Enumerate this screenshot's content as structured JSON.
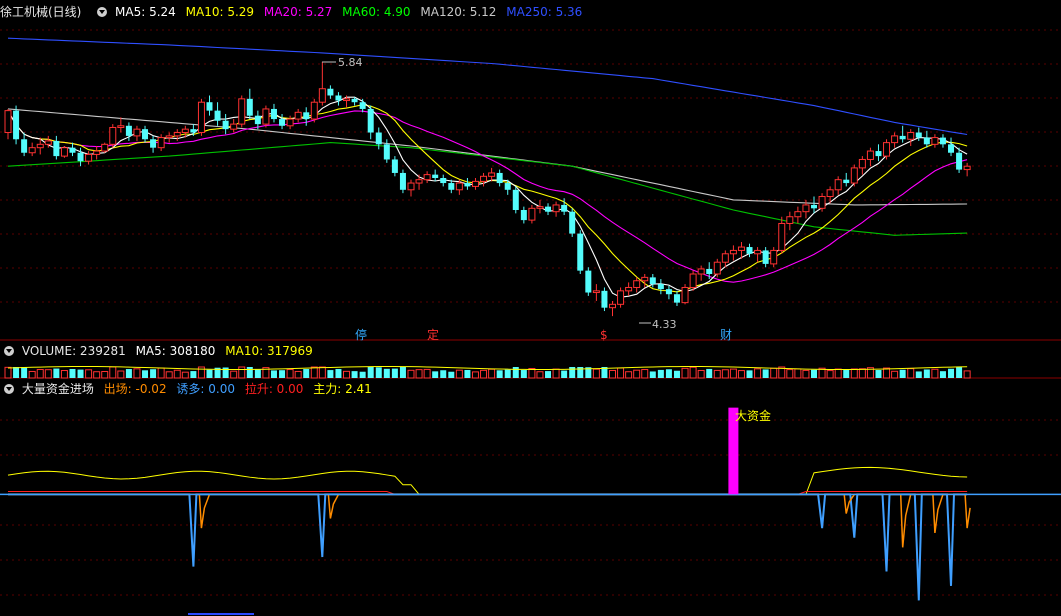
{
  "main_header": {
    "title": "徐工机械(日线)",
    "items": [
      {
        "label": "MA5: 5.24",
        "color": "#ffffff"
      },
      {
        "label": "MA10: 5.29",
        "color": "#ffff00"
      },
      {
        "label": "MA20: 5.27",
        "color": "#ff00ff"
      },
      {
        "label": "MA60: 4.90",
        "color": "#00ff00"
      },
      {
        "label": "MA120: 5.12",
        "color": "#c8c8c8"
      },
      {
        "label": "MA250: 5.36",
        "color": "#2f4fff"
      }
    ]
  },
  "volume_header": {
    "title": "VOLUME: 239281",
    "items": [
      {
        "label": "MA5: 308180",
        "color": "#ffffff"
      },
      {
        "label": "MA10: 317969",
        "color": "#ffff00"
      }
    ]
  },
  "indicator_header": {
    "title": "大量资金进场",
    "items": [
      {
        "label": "出场: -0.02",
        "color": "#ff8c00"
      },
      {
        "label": "诱多: 0.00",
        "color": "#3f9fff"
      },
      {
        "label": "拉升: 0.00",
        "color": "#ff2020"
      },
      {
        "label": "主力: 2.41",
        "color": "#ffff00"
      }
    ]
  },
  "annotations": {
    "high_label": "5.84",
    "low_label": "4.33",
    "big_money_label": "大资金",
    "markers": [
      {
        "text": "停",
        "color": "#33aaff"
      },
      {
        "text": "定",
        "color": "#ff3030"
      },
      {
        "text": "$",
        "color": "#ff3030"
      },
      {
        "text": "财",
        "color": "#33aaff"
      }
    ]
  },
  "chart_data": [
    {
      "type": "candlestick",
      "title": "徐工机械(日线)",
      "ylim": [
        4.2,
        6.1
      ],
      "price_high": 5.84,
      "price_low": 4.33,
      "candles": [
        [
          5.42,
          5.56,
          5.38,
          5.55
        ],
        [
          5.55,
          5.58,
          5.35,
          5.38
        ],
        [
          5.38,
          5.42,
          5.28,
          5.3
        ],
        [
          5.3,
          5.36,
          5.28,
          5.33
        ],
        [
          5.33,
          5.39,
          5.29,
          5.35
        ],
        [
          5.35,
          5.4,
          5.33,
          5.37
        ],
        [
          5.37,
          5.4,
          5.26,
          5.28
        ],
        [
          5.28,
          5.34,
          5.27,
          5.33
        ],
        [
          5.33,
          5.36,
          5.28,
          5.3
        ],
        [
          5.3,
          5.33,
          5.22,
          5.25
        ],
        [
          5.25,
          5.31,
          5.23,
          5.29
        ],
        [
          5.29,
          5.34,
          5.26,
          5.31
        ],
        [
          5.31,
          5.36,
          5.3,
          5.35
        ],
        [
          5.35,
          5.47,
          5.33,
          5.45
        ],
        [
          5.45,
          5.51,
          5.42,
          5.46
        ],
        [
          5.46,
          5.48,
          5.37,
          5.4
        ],
        [
          5.4,
          5.46,
          5.37,
          5.44
        ],
        [
          5.44,
          5.46,
          5.36,
          5.38
        ],
        [
          5.38,
          5.4,
          5.3,
          5.33
        ],
        [
          5.33,
          5.41,
          5.31,
          5.39
        ],
        [
          5.39,
          5.42,
          5.36,
          5.4
        ],
        [
          5.4,
          5.44,
          5.37,
          5.42
        ],
        [
          5.42,
          5.46,
          5.39,
          5.44
        ],
        [
          5.44,
          5.47,
          5.4,
          5.42
        ],
        [
          5.42,
          5.62,
          5.4,
          5.6
        ],
        [
          5.6,
          5.64,
          5.52,
          5.55
        ],
        [
          5.55,
          5.6,
          5.46,
          5.49
        ],
        [
          5.49,
          5.53,
          5.41,
          5.44
        ],
        [
          5.44,
          5.5,
          5.42,
          5.47
        ],
        [
          5.47,
          5.64,
          5.45,
          5.62
        ],
        [
          5.62,
          5.68,
          5.5,
          5.52
        ],
        [
          5.52,
          5.55,
          5.44,
          5.47
        ],
        [
          5.47,
          5.58,
          5.45,
          5.56
        ],
        [
          5.56,
          5.59,
          5.48,
          5.5
        ],
        [
          5.5,
          5.53,
          5.44,
          5.46
        ],
        [
          5.46,
          5.52,
          5.44,
          5.5
        ],
        [
          5.5,
          5.56,
          5.48,
          5.54
        ],
        [
          5.54,
          5.57,
          5.46,
          5.5
        ],
        [
          5.5,
          5.62,
          5.48,
          5.6
        ],
        [
          5.6,
          5.84,
          5.58,
          5.68
        ],
        [
          5.68,
          5.7,
          5.62,
          5.64
        ],
        [
          5.64,
          5.66,
          5.58,
          5.61
        ],
        [
          5.61,
          5.64,
          5.57,
          5.62
        ],
        [
          5.62,
          5.63,
          5.58,
          5.6
        ],
        [
          5.6,
          5.62,
          5.54,
          5.56
        ],
        [
          5.56,
          5.58,
          5.38,
          5.42
        ],
        [
          5.42,
          5.45,
          5.32,
          5.35
        ],
        [
          5.35,
          5.38,
          5.24,
          5.26
        ],
        [
          5.26,
          5.28,
          5.16,
          5.18
        ],
        [
          5.18,
          5.2,
          5.06,
          5.08
        ],
        [
          5.08,
          5.14,
          5.04,
          5.12
        ],
        [
          5.12,
          5.17,
          5.08,
          5.14
        ],
        [
          5.14,
          5.19,
          5.12,
          5.17
        ],
        [
          5.17,
          5.2,
          5.13,
          5.15
        ],
        [
          5.15,
          5.17,
          5.1,
          5.12
        ],
        [
          5.12,
          5.14,
          5.06,
          5.08
        ],
        [
          5.08,
          5.14,
          5.05,
          5.12
        ],
        [
          5.12,
          5.15,
          5.08,
          5.1
        ],
        [
          5.1,
          5.15,
          5.08,
          5.13
        ],
        [
          5.13,
          5.18,
          5.1,
          5.16
        ],
        [
          5.16,
          5.21,
          5.13,
          5.18
        ],
        [
          5.18,
          5.2,
          5.1,
          5.12
        ],
        [
          5.12,
          5.14,
          5.05,
          5.08
        ],
        [
          5.08,
          5.1,
          4.94,
          4.96
        ],
        [
          4.96,
          4.98,
          4.88,
          4.9
        ],
        [
          4.9,
          4.99,
          4.88,
          4.97
        ],
        [
          4.97,
          5.02,
          4.94,
          4.98
        ],
        [
          4.98,
          5.0,
          4.93,
          4.95
        ],
        [
          4.95,
          5.01,
          4.92,
          4.99
        ],
        [
          4.99,
          5.03,
          4.93,
          4.95
        ],
        [
          4.95,
          4.97,
          4.8,
          4.82
        ],
        [
          4.82,
          4.84,
          4.58,
          4.6
        ],
        [
          4.6,
          4.62,
          4.45,
          4.47
        ],
        [
          4.47,
          4.52,
          4.42,
          4.48
        ],
        [
          4.48,
          4.5,
          4.36,
          4.38
        ],
        [
          4.38,
          4.42,
          4.33,
          4.4
        ],
        [
          4.4,
          4.5,
          4.38,
          4.48
        ],
        [
          4.48,
          4.53,
          4.45,
          4.5
        ],
        [
          4.5,
          4.56,
          4.47,
          4.54
        ],
        [
          4.54,
          4.58,
          4.5,
          4.56
        ],
        [
          4.56,
          4.58,
          4.5,
          4.52
        ],
        [
          4.52,
          4.55,
          4.46,
          4.49
        ],
        [
          4.49,
          4.51,
          4.43,
          4.46
        ],
        [
          4.46,
          4.48,
          4.39,
          4.41
        ],
        [
          4.41,
          4.52,
          4.4,
          4.5
        ],
        [
          4.5,
          4.6,
          4.48,
          4.58
        ],
        [
          4.58,
          4.63,
          4.54,
          4.61
        ],
        [
          4.61,
          4.65,
          4.55,
          4.58
        ],
        [
          4.58,
          4.67,
          4.56,
          4.65
        ],
        [
          4.65,
          4.72,
          4.62,
          4.7
        ],
        [
          4.7,
          4.75,
          4.66,
          4.72
        ],
        [
          4.72,
          4.77,
          4.67,
          4.74
        ],
        [
          4.74,
          4.76,
          4.68,
          4.7
        ],
        [
          4.7,
          4.74,
          4.65,
          4.72
        ],
        [
          4.72,
          4.74,
          4.62,
          4.64
        ],
        [
          4.64,
          4.74,
          4.62,
          4.72
        ],
        [
          4.72,
          4.92,
          4.7,
          4.88
        ],
        [
          4.88,
          4.95,
          4.84,
          4.92
        ],
        [
          4.92,
          4.98,
          4.88,
          4.95
        ],
        [
          4.95,
          5.02,
          4.91,
          4.99
        ],
        [
          4.99,
          5.04,
          4.94,
          4.97
        ],
        [
          4.97,
          5.06,
          4.95,
          5.04
        ],
        [
          5.04,
          5.1,
          5.0,
          5.08
        ],
        [
          5.08,
          5.16,
          5.05,
          5.14
        ],
        [
          5.14,
          5.18,
          5.1,
          5.12
        ],
        [
          5.12,
          5.23,
          5.1,
          5.21
        ],
        [
          5.21,
          5.28,
          5.17,
          5.26
        ],
        [
          5.26,
          5.33,
          5.22,
          5.31
        ],
        [
          5.31,
          5.35,
          5.25,
          5.28
        ],
        [
          5.28,
          5.38,
          5.26,
          5.36
        ],
        [
          5.36,
          5.42,
          5.33,
          5.4
        ],
        [
          5.4,
          5.46,
          5.36,
          5.38
        ],
        [
          5.38,
          5.44,
          5.34,
          5.42
        ],
        [
          5.42,
          5.45,
          5.37,
          5.39
        ],
        [
          5.39,
          5.43,
          5.33,
          5.35
        ],
        [
          5.35,
          5.41,
          5.33,
          5.39
        ],
        [
          5.39,
          5.41,
          5.33,
          5.35
        ],
        [
          5.35,
          5.39,
          5.28,
          5.3
        ],
        [
          5.3,
          5.33,
          5.18,
          5.2
        ],
        [
          5.2,
          5.24,
          5.16,
          5.22
        ]
      ],
      "ma_series": [
        {
          "name": "MA5",
          "value": 5.24,
          "color": "#ffffff"
        },
        {
          "name": "MA10",
          "value": 5.29,
          "color": "#ffff00"
        },
        {
          "name": "MA20",
          "value": 5.27,
          "color": "#ff00ff"
        },
        {
          "name": "MA60",
          "value": 4.9,
          "color": "#00ff00"
        },
        {
          "name": "MA120",
          "value": 5.12,
          "color": "#c8c8c8"
        },
        {
          "name": "MA250",
          "value": 5.36,
          "color": "#2f4fff"
        }
      ],
      "ma250_points": [
        [
          0,
          5.98
        ],
        [
          20,
          5.94
        ],
        [
          40,
          5.89
        ],
        [
          60,
          5.83
        ],
        [
          80,
          5.74
        ],
        [
          100,
          5.58
        ],
        [
          110,
          5.48
        ],
        [
          120,
          5.4
        ],
        [
          131,
          5.36
        ]
      ],
      "ma120_points": [
        [
          0,
          5.56
        ],
        [
          30,
          5.44
        ],
        [
          50,
          5.34
        ],
        [
          70,
          5.22
        ],
        [
          90,
          5.02
        ],
        [
          105,
          4.99
        ],
        [
          131,
          5.0
        ]
      ],
      "ma60_points": [
        [
          0,
          5.22
        ],
        [
          20,
          5.28
        ],
        [
          40,
          5.36
        ],
        [
          50,
          5.33
        ],
        [
          70,
          5.22
        ],
        [
          90,
          4.96
        ],
        [
          100,
          4.86
        ],
        [
          110,
          4.81
        ],
        [
          131,
          4.84
        ]
      ]
    },
    {
      "type": "bar",
      "title": "VOLUME: 239281",
      "volume_value": 239281,
      "ma5": 308180,
      "ma10": 317969,
      "ylim": [
        0,
        1000000
      ]
    },
    {
      "type": "line",
      "title": "大量资金进场",
      "ylim": [
        -12,
        10
      ],
      "series": [
        {
          "name": "出场",
          "value": -0.02,
          "color": "#ff8c00"
        },
        {
          "name": "诱多",
          "value": 0.0,
          "color": "#3f9fff"
        },
        {
          "name": "拉升",
          "value": 0.0,
          "color": "#ff2020"
        },
        {
          "name": "主力",
          "value": 2.41,
          "color": "#ffff00"
        }
      ],
      "big_money_index": 90,
      "big_money_value": 9
    }
  ]
}
